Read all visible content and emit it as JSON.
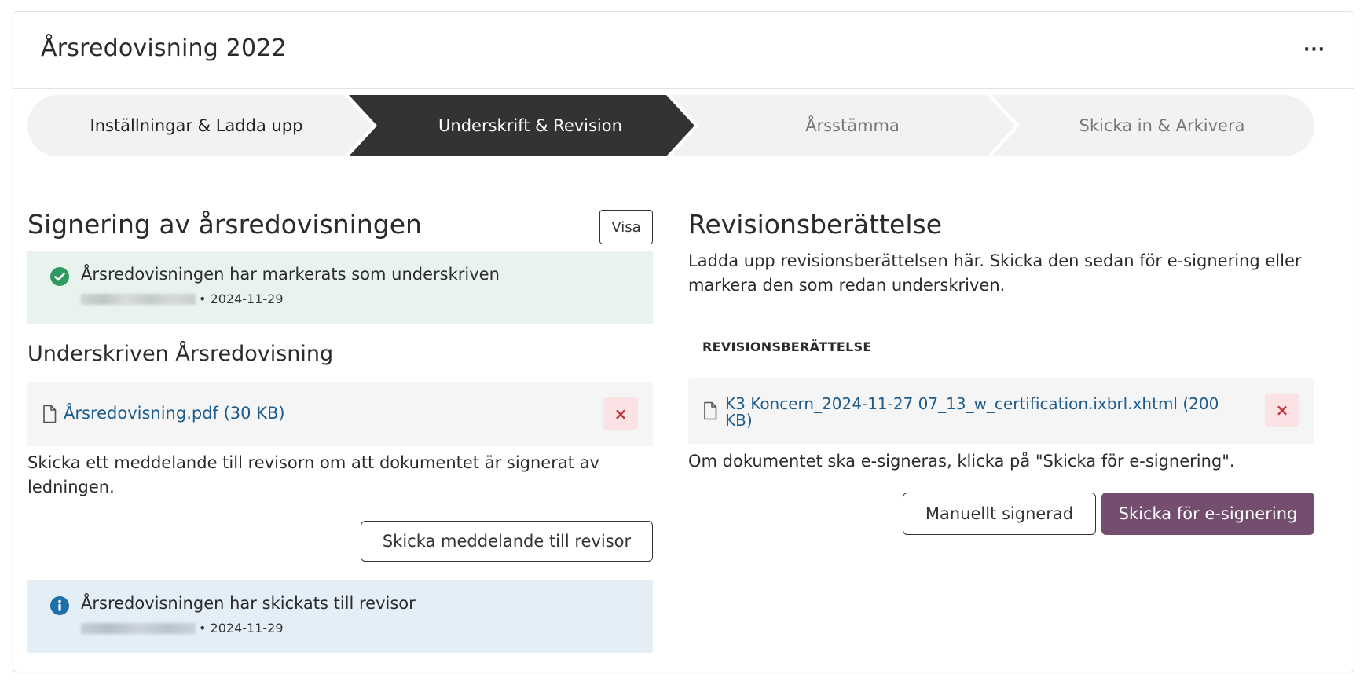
{
  "header": {
    "title": "Årsredovisning 2022",
    "more_label": "···"
  },
  "stepper": {
    "steps": [
      {
        "label": "Inställningar & Ladda upp",
        "state": "completed"
      },
      {
        "label": "Underskrift & Revision",
        "state": "active"
      },
      {
        "label": "Årsstämma",
        "state": "upcoming"
      },
      {
        "label": "Skicka in & Arkivera",
        "state": "upcoming"
      }
    ],
    "colors": {
      "active": "#333333",
      "inactive": "#f2f2f2"
    }
  },
  "signing": {
    "title": "Signering av årsredovisningen",
    "view_button": "Visa",
    "signed_alert": {
      "title": "Årsredovisningen har markerats som underskriven",
      "date": "• 2024-11-29",
      "icon": "check-circle-icon",
      "color": "#2e9a5f"
    },
    "signed_doc": {
      "title": "Underskriven Årsredovisning",
      "file_name": "Årsredovisning.pdf (30 KB)",
      "delete_label": "×"
    },
    "message_text": "Skicka ett meddelande till revisorn om att dokumentet är signerat av ledningen.",
    "send_button": "Skicka meddelande till revisor",
    "sent_alert": {
      "title": "Årsredovisningen har skickats till revisor",
      "date": "• 2024-11-29",
      "icon": "info-circle-icon",
      "color": "#1f6fab"
    }
  },
  "audit_report": {
    "title": "Revisionsberättelse",
    "intro": "Ladda upp revisionsberättelsen här. Skicka den sedan för e-signering eller markera den som redan underskriven.",
    "section_label": "REVISIONSBERÄTTELSE",
    "file_name": "K3 Koncern_2024-11-27 07_13_w_certification.ixbrl.xhtml (200 KB)",
    "delete_label": "×",
    "note": "Om dokumentet ska e-signeras, klicka på \"Skicka för e-signering\".",
    "manual_button": "Manuellt signerad",
    "esign_button": "Skicka för e-signering",
    "accent_color": "#744e6e"
  }
}
